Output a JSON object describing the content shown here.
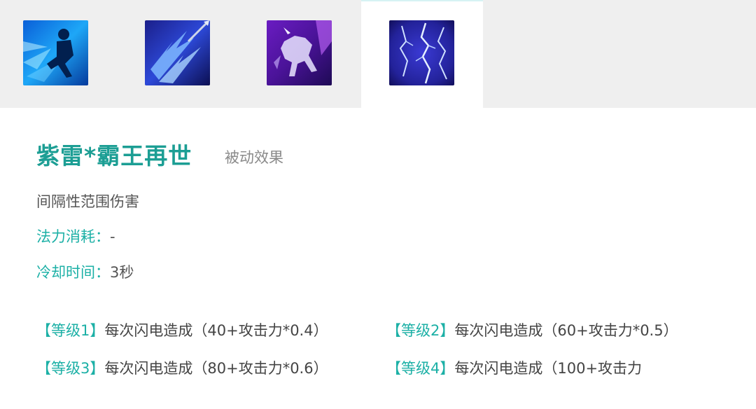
{
  "tabs": [
    {
      "icon": "sprint-icon",
      "active": false
    },
    {
      "icon": "lightning-spear-icon",
      "active": false
    },
    {
      "icon": "thunder-horse-icon",
      "active": false
    },
    {
      "icon": "purple-lightning-icon",
      "active": true
    }
  ],
  "skill": {
    "name": "紫雷*霸王再世",
    "type": "被动效果",
    "description": "间隔性范围伤害",
    "mana_label": "法力消耗：",
    "mana_value": "-",
    "cooldown_label": "冷却时间：",
    "cooldown_value": "3秒"
  },
  "levels": [
    {
      "label": "【等级1】",
      "text": "每次闪电造成（40+攻击力*0.4）"
    },
    {
      "label": "【等级2】",
      "text": "每次闪电造成（60+攻击力*0.5）"
    },
    {
      "label": "【等级3】",
      "text": "每次闪电造成（80+攻击力*0.6）"
    },
    {
      "label": "【等级4】",
      "text": "每次闪电造成（100+攻击力"
    }
  ],
  "colors": {
    "accent": "#1cb0a6",
    "title": "#1c9e94",
    "tab_bg": "#efefef"
  }
}
